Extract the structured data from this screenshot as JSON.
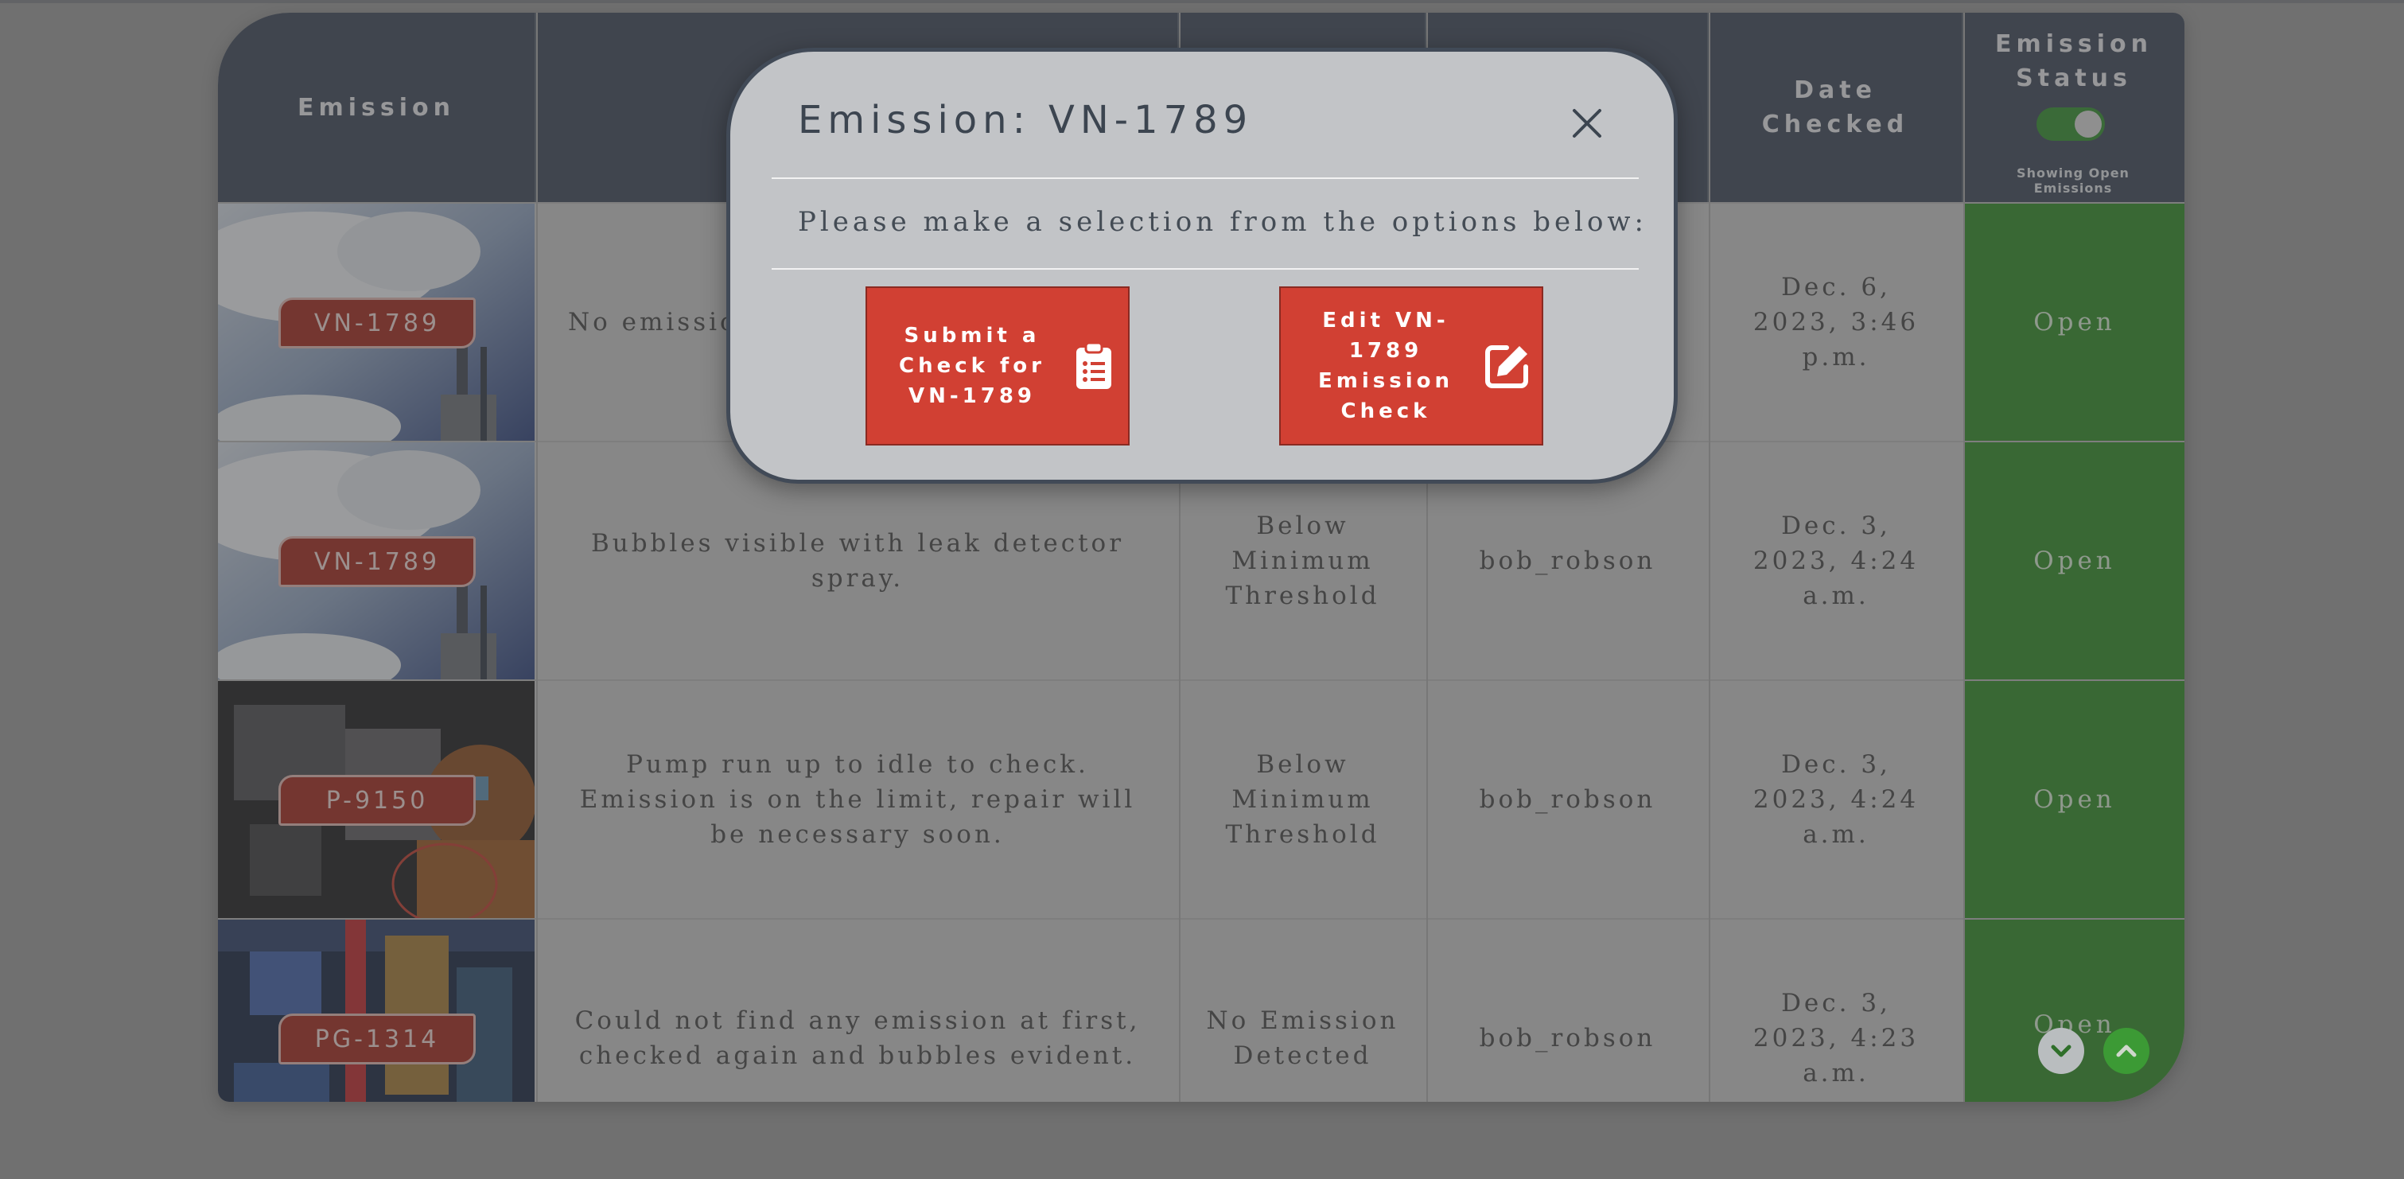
{
  "modal": {
    "title": "Emission: VN-1789",
    "prompt": "Please make a selection from the options below:",
    "submit_label": "Submit a Check for VN-1789",
    "edit_label": "Edit VN-1789 Emission Check"
  },
  "table": {
    "headers": {
      "emission": "Emission",
      "date_checked": "Date Checked",
      "status": "Emission Status"
    },
    "status_toggle_caption": "Showing Open Emissions",
    "rows": [
      {
        "tag": "VN-1789",
        "notes": "No emissio… dependan…",
        "result": "",
        "user": "",
        "date": "Dec. 6, 2023, 3:46 p.m.",
        "status": "Open"
      },
      {
        "tag": "VN-1789",
        "notes": "Bubbles visible with leak detector spray.",
        "result": "Below Minimum Threshold",
        "user": "bob_robson",
        "date": "Dec. 3, 2023, 4:24 a.m.",
        "status": "Open"
      },
      {
        "tag": "P-9150",
        "notes": "Pump run up to idle to check. Emission is on the limit, repair will be necessary soon.",
        "result": "Below Minimum Threshold",
        "user": "bob_robson",
        "date": "Dec. 3, 2023, 4:24 a.m.",
        "status": "Open"
      },
      {
        "tag": "PG-1314",
        "notes": "Could not find any emission at first, checked again and bubbles evident.",
        "result": "No Emission Detected",
        "user": "bob_robson",
        "date": "Dec. 3, 2023, 4:23 a.m.",
        "status": "Open"
      }
    ]
  },
  "colors": {
    "accent_red": "#d14033",
    "status_green": "#2c8a22",
    "header_dark": "#3a4556"
  },
  "icons": {
    "close": "close-icon",
    "clipboard": "clipboard-list-icon",
    "edit": "edit-pencil-icon",
    "scroll_down": "chevron-down-icon",
    "scroll_up": "chevron-up-icon"
  }
}
